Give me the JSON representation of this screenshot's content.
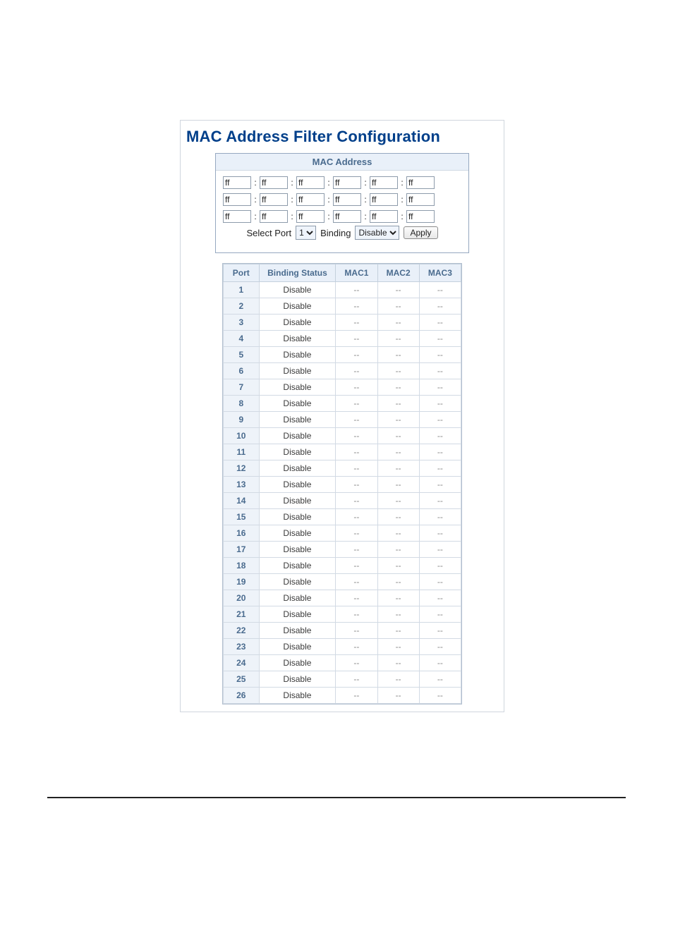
{
  "title": "MAC Address Filter Configuration",
  "mac_box": {
    "header": "MAC Address",
    "rows": [
      [
        "ff",
        "ff",
        "ff",
        "ff",
        "ff",
        "ff"
      ],
      [
        "ff",
        "ff",
        "ff",
        "ff",
        "ff",
        "ff"
      ],
      [
        "ff",
        "ff",
        "ff",
        "ff",
        "ff",
        "ff"
      ]
    ]
  },
  "controls": {
    "select_port_label": "Select Port",
    "port_value": "1",
    "binding_label": "Binding",
    "binding_value": "Disable",
    "apply_label": "Apply"
  },
  "table": {
    "headers": [
      "Port",
      "Binding Status",
      "MAC1",
      "MAC2",
      "MAC3"
    ],
    "rows": [
      {
        "port": "1",
        "binding": "Disable",
        "mac1": "--",
        "mac2": "--",
        "mac3": "--"
      },
      {
        "port": "2",
        "binding": "Disable",
        "mac1": "--",
        "mac2": "--",
        "mac3": "--"
      },
      {
        "port": "3",
        "binding": "Disable",
        "mac1": "--",
        "mac2": "--",
        "mac3": "--"
      },
      {
        "port": "4",
        "binding": "Disable",
        "mac1": "--",
        "mac2": "--",
        "mac3": "--"
      },
      {
        "port": "5",
        "binding": "Disable",
        "mac1": "--",
        "mac2": "--",
        "mac3": "--"
      },
      {
        "port": "6",
        "binding": "Disable",
        "mac1": "--",
        "mac2": "--",
        "mac3": "--"
      },
      {
        "port": "7",
        "binding": "Disable",
        "mac1": "--",
        "mac2": "--",
        "mac3": "--"
      },
      {
        "port": "8",
        "binding": "Disable",
        "mac1": "--",
        "mac2": "--",
        "mac3": "--"
      },
      {
        "port": "9",
        "binding": "Disable",
        "mac1": "--",
        "mac2": "--",
        "mac3": "--"
      },
      {
        "port": "10",
        "binding": "Disable",
        "mac1": "--",
        "mac2": "--",
        "mac3": "--"
      },
      {
        "port": "11",
        "binding": "Disable",
        "mac1": "--",
        "mac2": "--",
        "mac3": "--"
      },
      {
        "port": "12",
        "binding": "Disable",
        "mac1": "--",
        "mac2": "--",
        "mac3": "--"
      },
      {
        "port": "13",
        "binding": "Disable",
        "mac1": "--",
        "mac2": "--",
        "mac3": "--"
      },
      {
        "port": "14",
        "binding": "Disable",
        "mac1": "--",
        "mac2": "--",
        "mac3": "--"
      },
      {
        "port": "15",
        "binding": "Disable",
        "mac1": "--",
        "mac2": "--",
        "mac3": "--"
      },
      {
        "port": "16",
        "binding": "Disable",
        "mac1": "--",
        "mac2": "--",
        "mac3": "--"
      },
      {
        "port": "17",
        "binding": "Disable",
        "mac1": "--",
        "mac2": "--",
        "mac3": "--"
      },
      {
        "port": "18",
        "binding": "Disable",
        "mac1": "--",
        "mac2": "--",
        "mac3": "--"
      },
      {
        "port": "19",
        "binding": "Disable",
        "mac1": "--",
        "mac2": "--",
        "mac3": "--"
      },
      {
        "port": "20",
        "binding": "Disable",
        "mac1": "--",
        "mac2": "--",
        "mac3": "--"
      },
      {
        "port": "21",
        "binding": "Disable",
        "mac1": "--",
        "mac2": "--",
        "mac3": "--"
      },
      {
        "port": "22",
        "binding": "Disable",
        "mac1": "--",
        "mac2": "--",
        "mac3": "--"
      },
      {
        "port": "23",
        "binding": "Disable",
        "mac1": "--",
        "mac2": "--",
        "mac3": "--"
      },
      {
        "port": "24",
        "binding": "Disable",
        "mac1": "--",
        "mac2": "--",
        "mac3": "--"
      },
      {
        "port": "25",
        "binding": "Disable",
        "mac1": "--",
        "mac2": "--",
        "mac3": "--"
      },
      {
        "port": "26",
        "binding": "Disable",
        "mac1": "--",
        "mac2": "--",
        "mac3": "--"
      }
    ]
  }
}
